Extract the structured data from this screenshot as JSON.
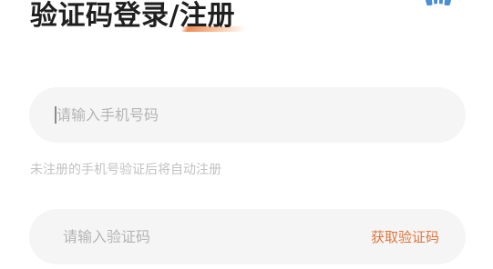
{
  "header": {
    "title_part1": "验证码登录/",
    "title_part2": "注册"
  },
  "phone_field": {
    "placeholder": "请输入手机号码",
    "value": ""
  },
  "hint": {
    "text": "未注册的手机号验证后将自动注册"
  },
  "code_field": {
    "placeholder": "请输入验证码",
    "value": ""
  },
  "get_code_button": {
    "label": "获取验证码"
  },
  "colors": {
    "accent": "#e2763c",
    "title": "#1f1f1f",
    "field_bg": "#f5f5f5",
    "placeholder": "#b4b4b4",
    "hint": "#c2c2c2",
    "globe": "#4a8fd6"
  },
  "icons": {
    "top_right": "globe-icon"
  }
}
